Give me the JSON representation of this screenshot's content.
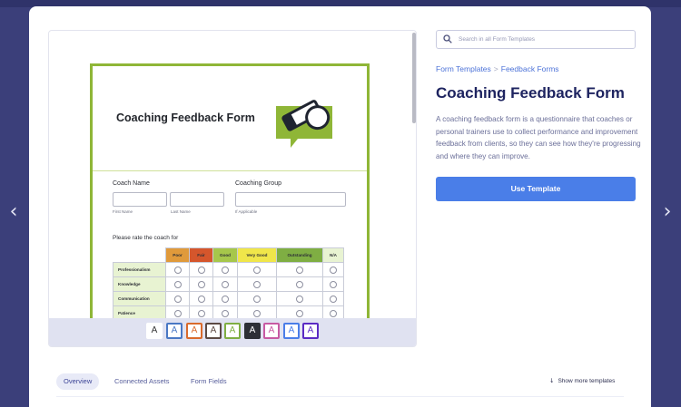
{
  "form_preview": {
    "title": "Coaching Feedback Form",
    "coach_name_label": "Coach Name",
    "coaching_group_label": "Coaching Group",
    "first_name_sub": "First Name",
    "last_name_sub": "Last Name",
    "if_applicable_sub": "If Applicable",
    "rate_title": "Please rate the coach for",
    "columns": [
      {
        "label": "Poor",
        "color": "#e09a3b"
      },
      {
        "label": "Fair",
        "color": "#d5562c"
      },
      {
        "label": "Good",
        "color": "#a6c74b"
      },
      {
        "label": "Very Good",
        "color": "#f0e64a"
      },
      {
        "label": "Outstanding",
        "color": "#7fae43"
      },
      {
        "label": "N/A",
        "color": "#e8f3d2"
      }
    ],
    "rows": [
      "Professionalism",
      "Knowledge",
      "Communication",
      "Patience"
    ]
  },
  "swatches": [
    {
      "label": "A",
      "border": "#ffffff",
      "color": "#333333"
    },
    {
      "label": "A",
      "border": "#4a78c4",
      "color": "#4a78c4"
    },
    {
      "label": "A",
      "border": "#d96a2c",
      "color": "#d96a2c"
    },
    {
      "label": "A",
      "border": "#5c4a44",
      "color": "#5c4a44"
    },
    {
      "label": "A",
      "border": "#7fae43",
      "color": "#7fae43"
    },
    {
      "label": "A",
      "border": "#2d2f36",
      "color": "#ffffff",
      "bg": "#2d2f36"
    },
    {
      "label": "A",
      "border": "#c75aa3",
      "color": "#c75aa3"
    },
    {
      "label": "A",
      "border": "#4a7ee8",
      "color": "#4a7ee8"
    },
    {
      "label": "A",
      "border": "#5b2bc4",
      "color": "#5b2bc4"
    }
  ],
  "search": {
    "placeholder": "Search in all Form Templates"
  },
  "breadcrumb": {
    "first": "Form Templates",
    "separator": ">",
    "second": "Feedback Forms"
  },
  "title": "Coaching Feedback Form",
  "description": "A coaching feedback form is a questionnaire that coaches or personal trainers use to collect performance and improvement feedback from clients, so they can see how they're progressing and where they can improve.",
  "use_template_label": "Use Template",
  "tabs": [
    {
      "label": "Overview",
      "active": true
    },
    {
      "label": "Connected Assets",
      "active": false
    },
    {
      "label": "Form Fields",
      "active": false
    }
  ],
  "show_more": "Show more templates",
  "nav": {
    "left": "‹",
    "right": "›"
  }
}
